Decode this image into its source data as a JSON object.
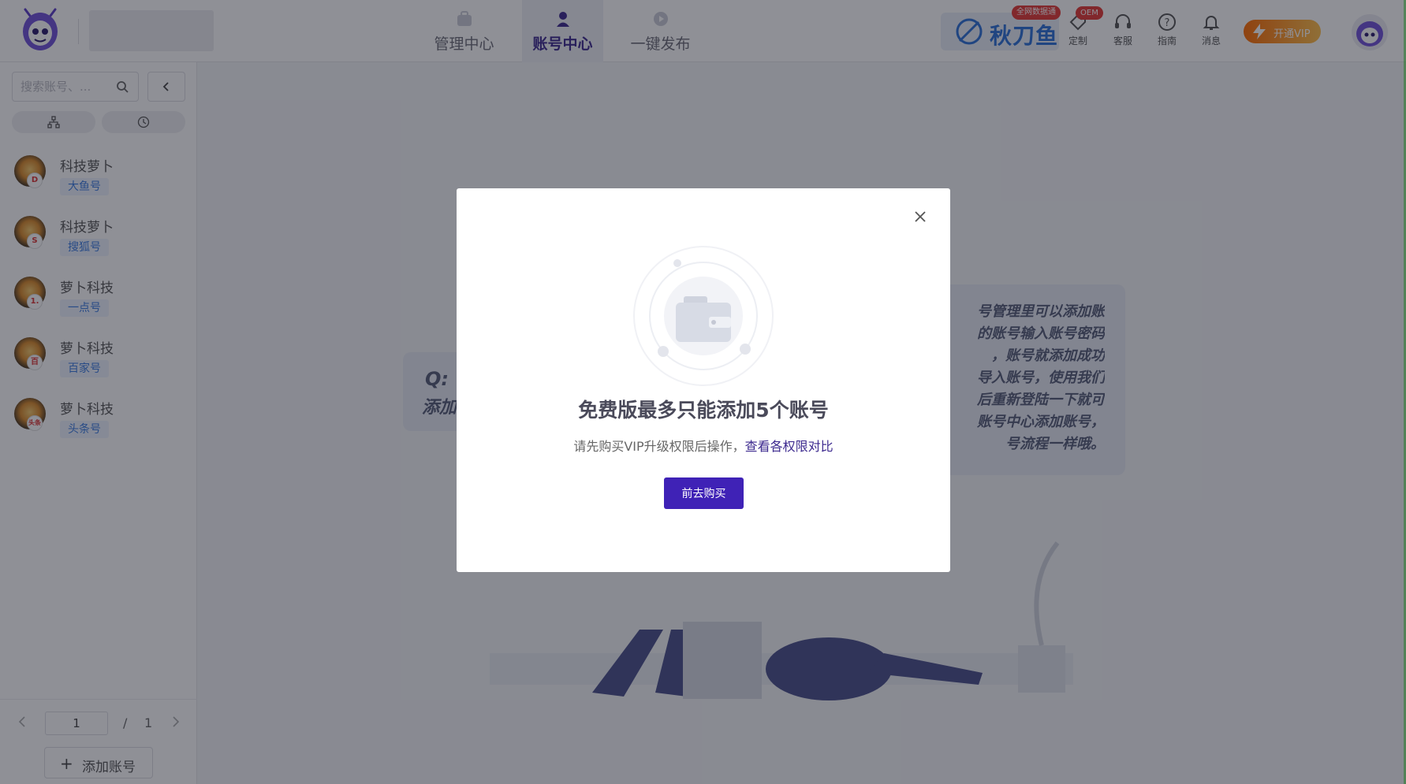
{
  "header": {
    "tabs": [
      {
        "label": "管理中心"
      },
      {
        "label": "账号中心"
      },
      {
        "label": "一键发布"
      }
    ],
    "active_tab_index": 1,
    "brand": {
      "name": "秋刀鱼",
      "tag": "全网数据通"
    },
    "tools": [
      {
        "label": "定制",
        "icon": "tag-icon"
      },
      {
        "label": "客服",
        "icon": "headset-icon"
      },
      {
        "label": "指南",
        "icon": "help-icon"
      },
      {
        "label": "消息",
        "icon": "bell-icon"
      }
    ],
    "oem_badge": "OEM",
    "vip_label": "开通VIP"
  },
  "sidebar": {
    "search_placeholder": "搜索账号、...",
    "accounts": [
      {
        "name": "科技萝卜",
        "platform": "大鱼号",
        "badge": "D"
      },
      {
        "name": "科技萝卜",
        "platform": "搜狐号",
        "badge": "S"
      },
      {
        "name": "萝卜科技",
        "platform": "一点号",
        "badge": "1."
      },
      {
        "name": "萝卜科技",
        "platform": "百家号",
        "badge": "百"
      },
      {
        "name": "萝卜科技",
        "platform": "头条号",
        "badge": "头条"
      }
    ],
    "pager": {
      "current": "1",
      "separator": "/",
      "total": "1"
    },
    "add_label": "添加账号"
  },
  "background": {
    "question": {
      "title": "Q:",
      "text": "添加"
    },
    "answer_lines": [
      "号管理里可以添加账",
      "的账号输入账号密码",
      "，账号就添加成功",
      "导入账号，使用我们",
      "后重新登陆一下就可",
      "账号中心添加账号，",
      "号流程一样哦。"
    ]
  },
  "modal": {
    "title": "免费版最多只能添加5个账号",
    "desc": "请先购买VIP升级权限后操作，",
    "link": "查看各权限对比",
    "button": "前去购买"
  },
  "colors": {
    "accent": "#3f22b6",
    "tag_blue": "#3b7be0",
    "vip_orange": "#ff6b00",
    "badge_red": "#e53935"
  }
}
